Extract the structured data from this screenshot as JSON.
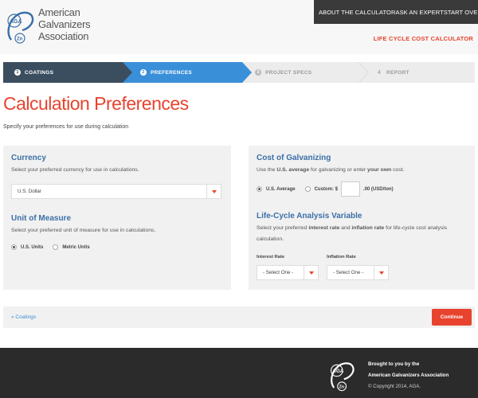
{
  "header": {
    "org_name_lines": [
      "American",
      "Galvanizers",
      "Association"
    ],
    "nav": [
      "ABOUT THE CALCULATOR",
      "ASK AN EXPERT",
      "START OVER"
    ],
    "app_title": "LIFE CYCLE COST CALCULATOR"
  },
  "steps": [
    {
      "num": "1",
      "label": "COATINGS",
      "state": "completed"
    },
    {
      "num": "2",
      "label": "PREFERENCES",
      "state": "active"
    },
    {
      "num": "3",
      "label": "PROJECT SPECS",
      "state": "upcoming"
    },
    {
      "num": "4",
      "label": "REPORT",
      "state": "upcoming"
    }
  ],
  "page": {
    "title": "Calculation Preferences",
    "subtitle": "Specify your preferences for use during calculation"
  },
  "currency": {
    "title": "Currency",
    "desc": "Select your preferred currency for use in calculations.",
    "selected": "U.S. Dollar"
  },
  "units": {
    "title": "Unit of Measure",
    "desc": "Select your preferred unit of measure for use in calculations.",
    "option_us": "U.S. Units",
    "option_metric": "Metric Units",
    "selected": "us"
  },
  "cost": {
    "title": "Cost of Galvanizing",
    "desc_pre": "Use the ",
    "desc_bold1": "U.S. average",
    "desc_mid": " for galvanizing or enter ",
    "desc_bold2": "your own",
    "desc_post": " cost.",
    "option_avg": "U.S. Average",
    "option_custom": "Custom: $",
    "custom_value": "",
    "unit_suffix": ".00 (USD/ton)"
  },
  "lca": {
    "title": "Life-Cycle Analysis Variable",
    "desc_pre": "Select your preferred ",
    "desc_bold1": "interest rate",
    "desc_mid": " and ",
    "desc_bold2": "inflation rate",
    "desc_post": " for life-cycle cost analysis calculation.",
    "interest_label": "Interest Rate",
    "inflation_label": "Inflation Rate",
    "interest_selected": "- Select One -",
    "inflation_selected": "- Select One -"
  },
  "actions": {
    "back": "« Coatings",
    "continue": "Continue"
  },
  "footer": {
    "line1": "Brought to you by the",
    "line2": "American Galvanizers Association",
    "copyright": "© Copyright 2014, AGA."
  },
  "colors": {
    "accent": "#e8432e",
    "active_step": "#3a8fd9",
    "done_step": "#3b4e60",
    "section_title": "#3b6fa7"
  }
}
